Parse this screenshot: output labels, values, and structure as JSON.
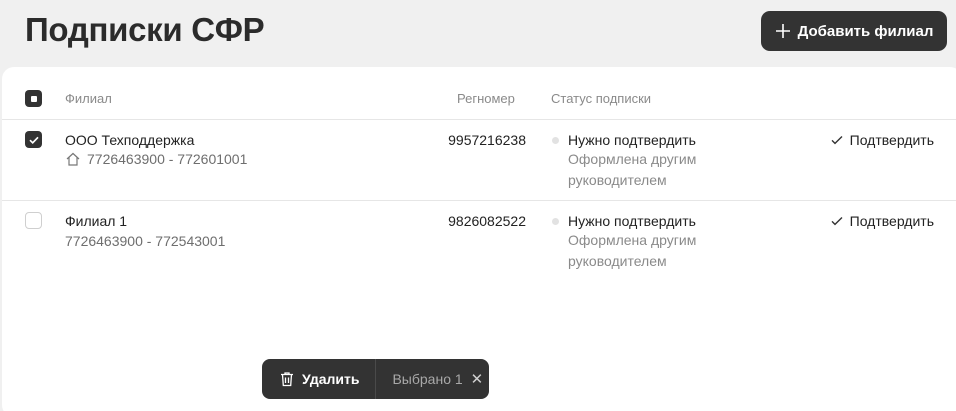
{
  "page": {
    "title": "Подписки СФР"
  },
  "toolbar": {
    "add_label": "Добавить филиал"
  },
  "table": {
    "columns": {
      "branch": "Филиал",
      "regnum": "Регномер",
      "status": "Статус подписки"
    },
    "rows": [
      {
        "name": "ООО Техподдержка",
        "inn_kpp": "7726463900 - 772601001",
        "regnum": "9957216238",
        "status": "Нужно подтвердить",
        "status_note": "Оформлена другим руководителем",
        "action": "Подтвердить",
        "checked": true,
        "is_head": true
      },
      {
        "name": "Филиал 1",
        "inn_kpp": "7726463900 - 772543001",
        "regnum": "9826082522",
        "status": "Нужно подтвердить",
        "status_note": "Оформлена другим руководителем",
        "action": "Подтвердить",
        "checked": false,
        "is_head": false
      }
    ]
  },
  "selection_bar": {
    "delete_label": "Удалить",
    "selected_label": "Выбрано 1",
    "close_glyph": "✕"
  },
  "colors": {
    "dark": "#333333",
    "background": "#f0f0f0",
    "muted": "#8a8a8a"
  },
  "icons": [
    "plus-icon",
    "check-icon",
    "home-icon",
    "trash-icon",
    "close-icon"
  ]
}
